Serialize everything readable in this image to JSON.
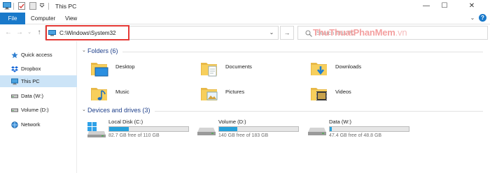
{
  "window": {
    "title": "This PC",
    "minimize_glyph": "—",
    "maximize_glyph": "☐",
    "close_glyph": "✕"
  },
  "ribbon": {
    "tabs": [
      "File",
      "Computer",
      "View"
    ],
    "collapse_glyph": "⌄",
    "help_glyph": "?"
  },
  "address": {
    "back_glyph": "←",
    "forward_glyph": "→",
    "recent_glyph": "⌄",
    "up_glyph": "↑",
    "path": "C:\\Windows\\System32",
    "dropdown_glyph": "⌄",
    "go_glyph": "→"
  },
  "search": {
    "placeholder": "Search This PC"
  },
  "watermark": {
    "part1": "ThuThuat",
    "part2": "PhanMem",
    "part3": ".vn"
  },
  "sidebar": {
    "items": [
      {
        "label": "Quick access",
        "icon": "star-icon"
      },
      {
        "label": "Dropbox",
        "icon": "dropbox-icon"
      },
      {
        "label": "This PC",
        "icon": "pc-icon",
        "selected": true
      },
      {
        "label": "Data (W:)",
        "icon": "drive-icon"
      },
      {
        "label": "Volume (D:)",
        "icon": "drive-icon"
      },
      {
        "label": "Network",
        "icon": "network-icon"
      }
    ]
  },
  "folders": {
    "heading": "Folders (6)",
    "chevron": "⌄",
    "items": [
      {
        "label": "Desktop",
        "icon": "desktop-folder-icon"
      },
      {
        "label": "Documents",
        "icon": "documents-folder-icon"
      },
      {
        "label": "Downloads",
        "icon": "downloads-folder-icon"
      },
      {
        "label": "Music",
        "icon": "music-folder-icon"
      },
      {
        "label": "Pictures",
        "icon": "pictures-folder-icon"
      },
      {
        "label": "Videos",
        "icon": "videos-folder-icon"
      }
    ]
  },
  "drives": {
    "heading": "Devices and drives (3)",
    "chevron": "⌄",
    "items": [
      {
        "label": "Local Disk (C:)",
        "free": "82.7 GB free of 110 GB",
        "used_fraction": 0.25,
        "icon": "windows-drive-icon"
      },
      {
        "label": "Volume (D:)",
        "free": "140 GB free of 183 GB",
        "used_fraction": 0.23,
        "icon": "drive-icon"
      },
      {
        "label": "Data (W:)",
        "free": "47.4 GB free of 48.8 GB",
        "used_fraction": 0.03,
        "icon": "drive-icon"
      }
    ]
  },
  "colors": {
    "accent": "#1979ca",
    "selection": "#cce4f7",
    "drive_fill": "#26a0da",
    "highlight_box": "#e53935",
    "group_heading": "#1e3f8a"
  }
}
